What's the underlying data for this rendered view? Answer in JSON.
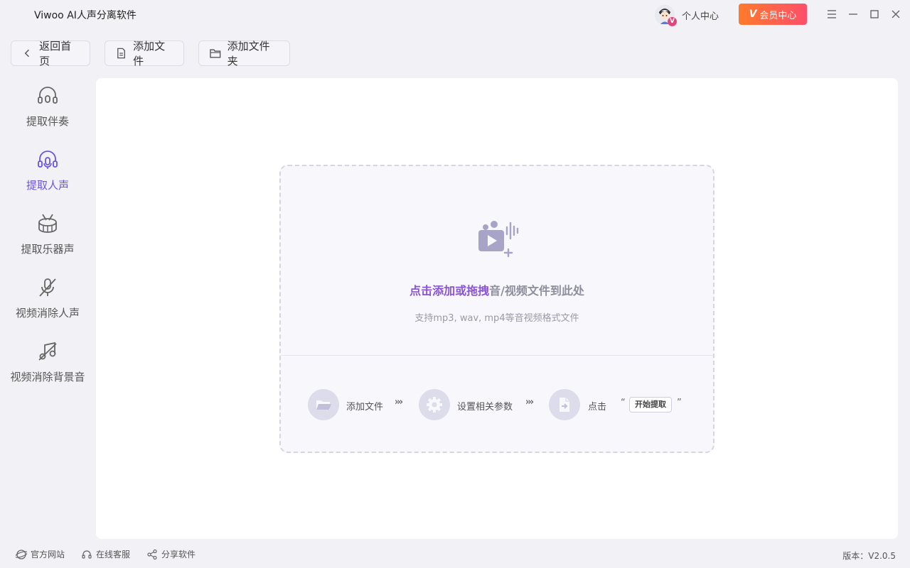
{
  "app": {
    "title": "Viwoo AI人声分离软件",
    "accent_color": "#6b52e5",
    "vip_gradient": [
      "#ff7a2b",
      "#ff4e6a"
    ]
  },
  "titlebar": {
    "personal_center": "个人中心",
    "vip_center": "会员中心",
    "vip_mark": "V",
    "avatar_badge": "V",
    "window_controls": [
      "menu-icon",
      "minimize-icon",
      "maximize-icon",
      "close-icon"
    ]
  },
  "toolbar": {
    "back_label": "返回首页",
    "add_file_label": "添加文件",
    "add_folder_label": "添加文件夹"
  },
  "sidebar": {
    "items": [
      {
        "label": "提取伴奏",
        "icon": "headphone-music-icon",
        "active": false
      },
      {
        "label": "提取人声",
        "icon": "headphone-mic-icon",
        "active": true
      },
      {
        "label": "提取乐器声",
        "icon": "drum-icon",
        "active": false
      },
      {
        "label": "视频消除人声",
        "icon": "mic-off-icon",
        "active": false
      },
      {
        "label": "视频消除背景音",
        "icon": "music-off-icon",
        "active": false
      }
    ]
  },
  "dropzone": {
    "highlight_text": "点击添加或拖拽",
    "rest_text": "音/视频文件到此处",
    "sub_text": "支持mp3, wav, mp4等音视频格式文件",
    "steps": [
      {
        "label": "添加文件",
        "icon": "folder-open-icon"
      },
      {
        "label": "设置相关参数",
        "icon": "gear-icon"
      },
      {
        "label": "点击",
        "icon": "file-export-icon"
      }
    ],
    "arrows": "›››",
    "quote_open": "“",
    "quote_close": "”",
    "start_label": "开始提取"
  },
  "footer": {
    "website": "官方网站",
    "support": "在线客服",
    "share": "分享软件",
    "version": "版本：V2.0.5"
  }
}
